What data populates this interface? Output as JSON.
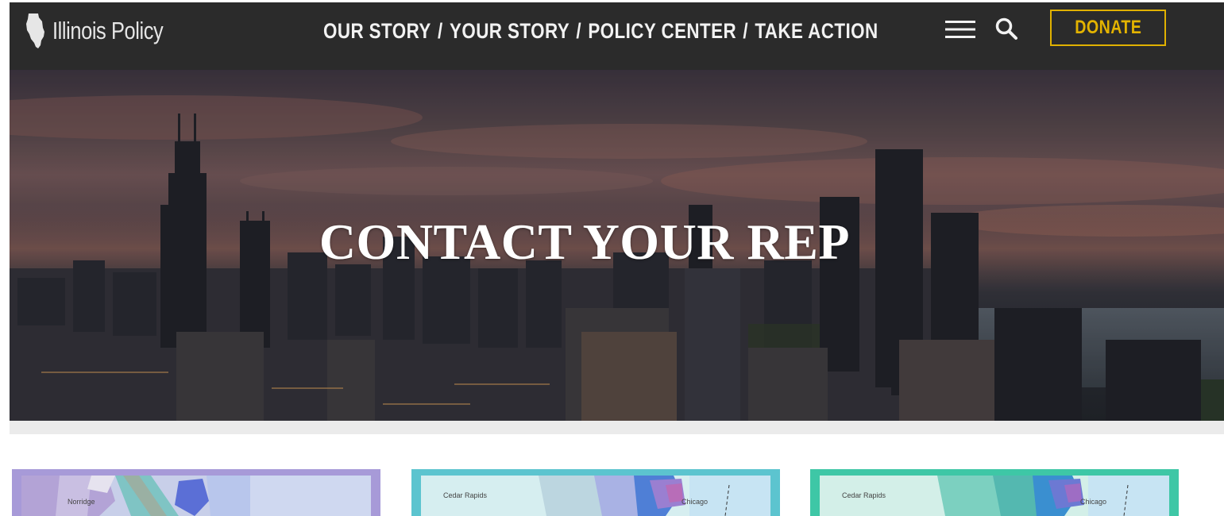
{
  "header": {
    "logo_text": "Illinois Policy",
    "nav": [
      "OUR STORY",
      "YOUR STORY",
      "POLICY CENTER",
      "TAKE ACTION"
    ],
    "separator": "/",
    "donate_label": "DONATE",
    "menu_icon": "hamburger-icon",
    "search_icon": "search-icon",
    "accent_color": "#e0b100",
    "bar_color": "#2b2b2b"
  },
  "hero": {
    "title": "CONTACT YOUR REP"
  },
  "maps": [
    {
      "labels": [
        "Norridge"
      ],
      "border_color": "#a79ad8"
    },
    {
      "labels": [
        "Cedar Rapids",
        "Chicago"
      ],
      "border_color": "#5cc4cf"
    },
    {
      "labels": [
        "Cedar Rapids",
        "Chicago"
      ],
      "border_color": "#3ec7a6"
    }
  ]
}
